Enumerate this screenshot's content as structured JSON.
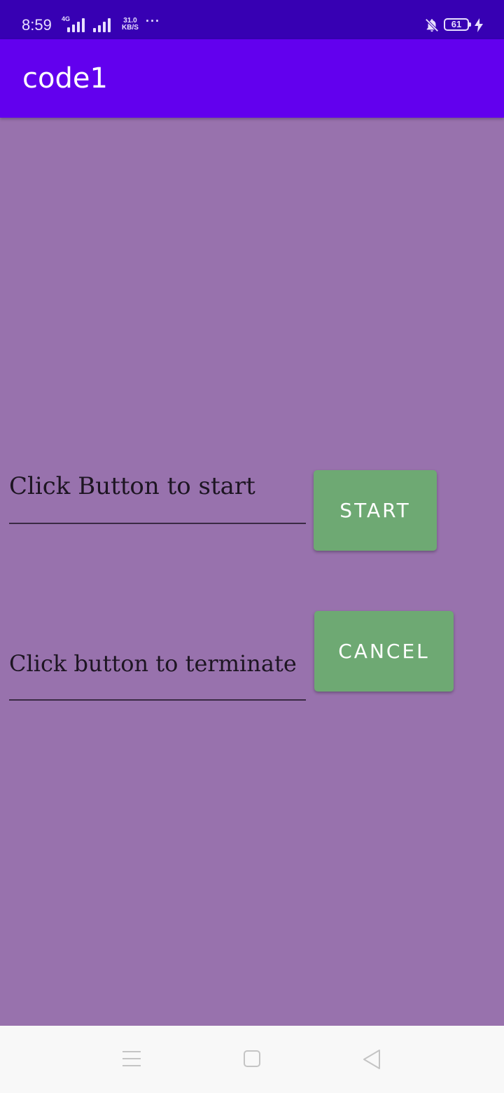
{
  "status_bar": {
    "time": "8:59",
    "network_type": "4G",
    "data_speed_value": "31.0",
    "data_speed_unit": "KB/S",
    "more": "···",
    "battery_level": "61",
    "icons": [
      "signal-4g-icon",
      "signal-icon",
      "bell-off-icon",
      "battery-icon",
      "charging-icon"
    ]
  },
  "app_bar": {
    "title": "code1"
  },
  "rows": {
    "start": {
      "input_value": "Click Button to start",
      "button_label": "START"
    },
    "cancel": {
      "input_value": "Click button to terminate",
      "button_label": "CANCEL"
    }
  },
  "nav_bar": {
    "icons": [
      "menu-icon",
      "home-icon",
      "back-icon"
    ]
  },
  "colors": {
    "status_bar": "#3700b3",
    "app_bar": "#6200ee",
    "background": "#9872ad",
    "button": "#6ea973",
    "nav_bar": "#f8f8f8"
  }
}
